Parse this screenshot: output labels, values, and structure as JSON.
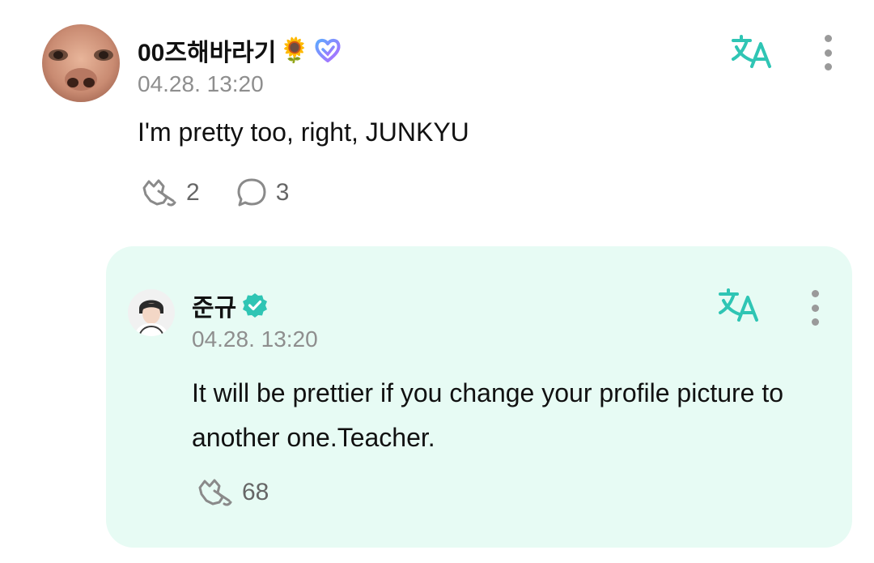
{
  "comment": {
    "author": "00즈해바라기",
    "author_emoji": "🌻",
    "timestamp": "04.28. 13:20",
    "text": "I'm pretty too, right, JUNKYU",
    "like_count": "2",
    "reply_count": "3",
    "icons": {
      "badge": "heart-outline-badge-icon",
      "translate": "translate-icon",
      "more": "more-vertical-icon",
      "like": "cheer-hand-icon",
      "reply": "speech-bubble-icon"
    }
  },
  "reply": {
    "author": "준규",
    "timestamp": "04.28. 13:20",
    "text": "It will be prettier if you change your profile picture to another one.Teacher.",
    "like_count": "68",
    "icons": {
      "badge": "verified-check-icon",
      "translate": "translate-icon",
      "more": "more-vertical-icon",
      "like": "cheer-hand-icon"
    }
  },
  "colors": {
    "accent_teal": "#2fc5b4",
    "reply_background": "#e7fbf4",
    "muted_text": "#8e8e8e",
    "badge_gradient_start": "#5ea8ff",
    "badge_gradient_end": "#b26bff"
  }
}
